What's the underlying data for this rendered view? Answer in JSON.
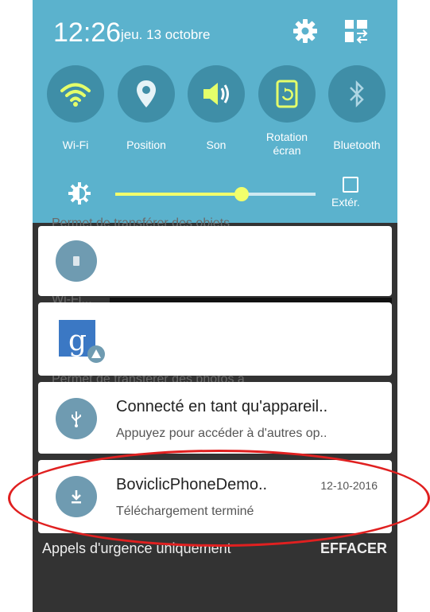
{
  "status": {
    "time": "12:26",
    "date": "jeu. 13 octobre"
  },
  "quick_settings": {
    "toggles": [
      {
        "label": "Wi-Fi",
        "icon": "wifi-icon"
      },
      {
        "label": "Position",
        "icon": "location-icon"
      },
      {
        "label": "Son",
        "icon": "volume-icon"
      },
      {
        "label_line1": "Rotation",
        "label_line2": "écran",
        "icon": "rotation-icon"
      },
      {
        "label": "Bluetooth",
        "icon": "bluetooth-icon"
      }
    ],
    "brightness": {
      "level": 0.63
    },
    "extra_label": "Extér."
  },
  "behind_text": {
    "line1": "Permet de transférer des objets",
    "line2": "Wi-Fi...",
    "line3": "Permet de transférer des photos à"
  },
  "notifications": [
    {
      "icon": "phone-icon"
    },
    {
      "icon": "google-icon"
    },
    {
      "icon": "usb-icon",
      "title": "Connecté en tant qu'appareil..",
      "subtitle": "Appuyez pour accéder à d'autres op.."
    },
    {
      "icon": "download-icon",
      "title": "BoviclicPhoneDemo..",
      "time": "12-10-2016",
      "subtitle": "Téléchargement terminé"
    }
  ],
  "footer": {
    "emergency": "Appels d'urgence uniquement",
    "clear": "EFFACER"
  },
  "colors": {
    "panel": "#5bb2cd",
    "toggle": "#3f8ea7",
    "active": "#f2ff6b",
    "annotation": "#e02020"
  }
}
